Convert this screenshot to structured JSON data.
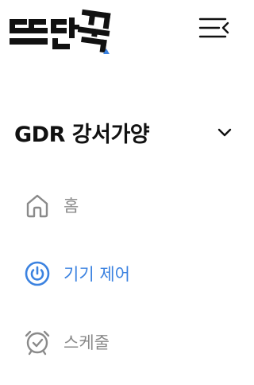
{
  "brand": {
    "logo_text": "또딱",
    "accent_color": "#3b82e0"
  },
  "header": {
    "menu_icon": "menu-collapse-icon"
  },
  "site": {
    "name": "GDR 강서가양",
    "toggle_icon": "chevron-down-icon"
  },
  "nav": {
    "items": [
      {
        "label": "홈",
        "icon": "home-icon",
        "active": false
      },
      {
        "label": "기기 제어",
        "icon": "power-icon",
        "active": true
      },
      {
        "label": "스케줄",
        "icon": "alarm-clock-icon",
        "active": false
      }
    ]
  },
  "colors": {
    "active": "#3b82e0",
    "inactive": "#8a8a8a",
    "text": "#111111"
  }
}
